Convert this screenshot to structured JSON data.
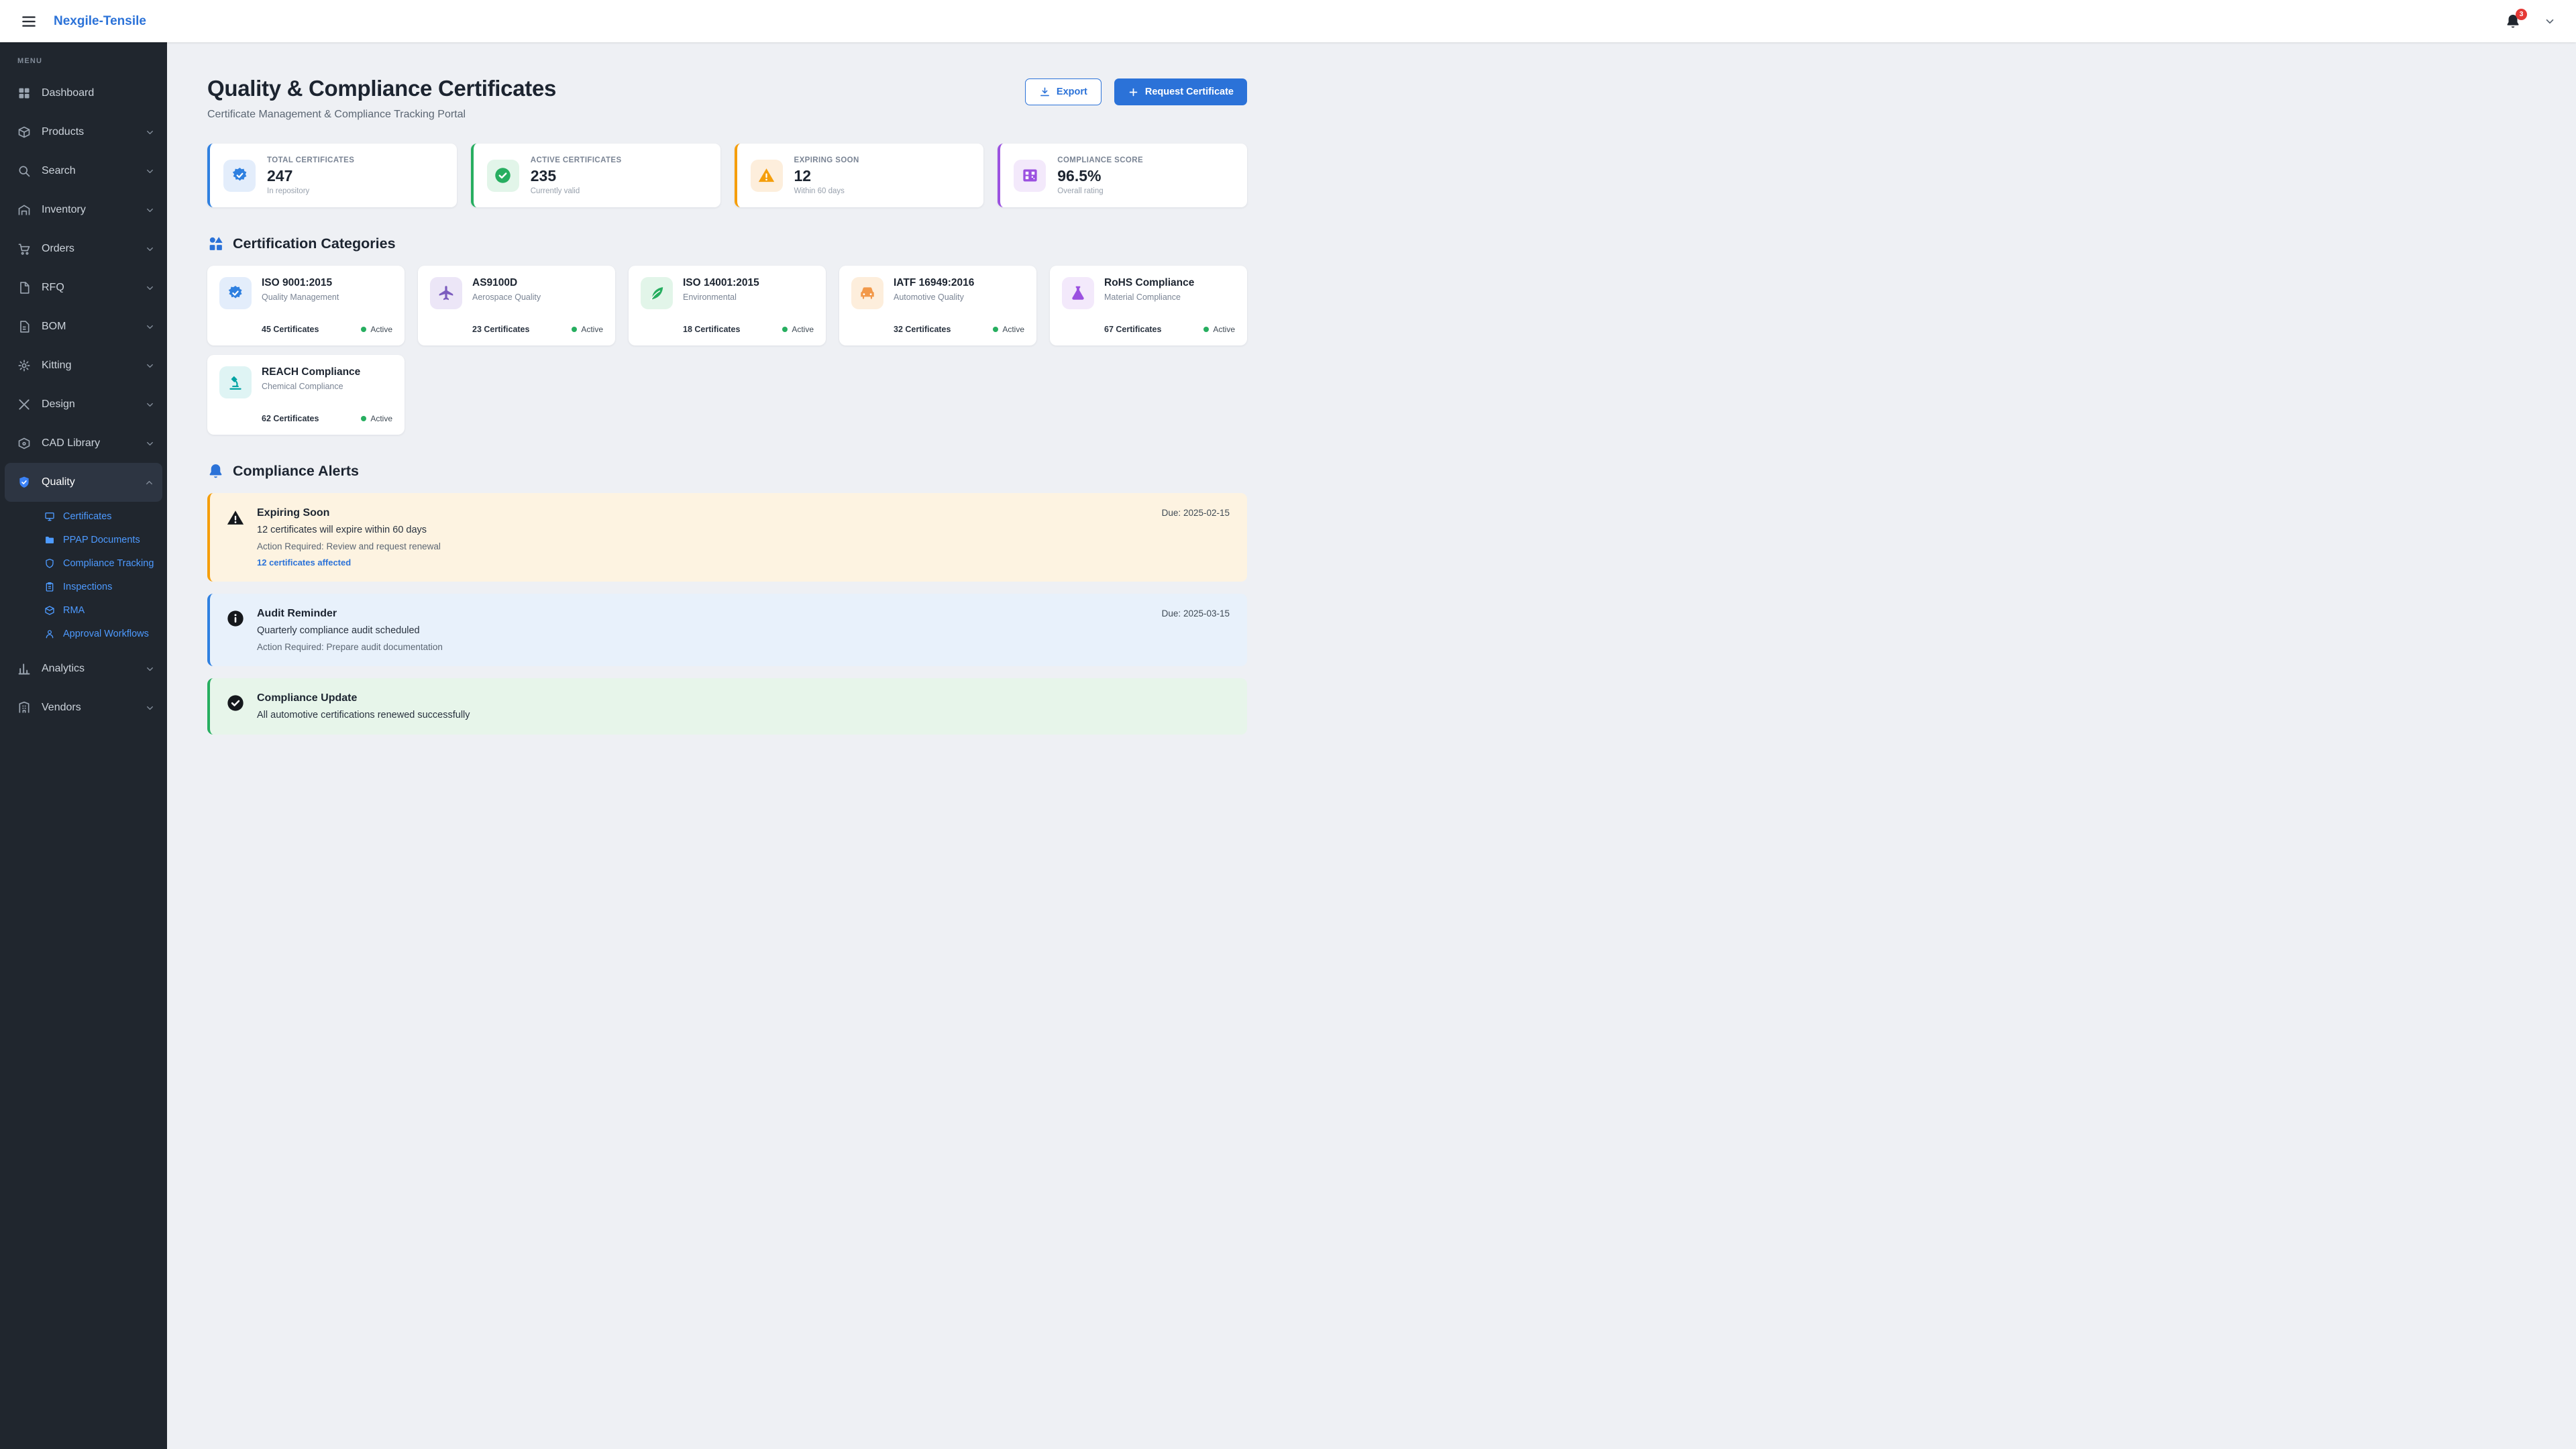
{
  "colors": {
    "primary": "#2b72d8",
    "sidebar_bg": "#20262e",
    "link_blue": "#4d9aff",
    "success": "#27ae60",
    "warning": "#f59e0b",
    "badge_red": "#e53935"
  },
  "topbar": {
    "brand": "Nexgile-Tensile",
    "notification_count": "3"
  },
  "sidebar": {
    "menu_label": "MENU",
    "items": [
      {
        "label": "Dashboard"
      },
      {
        "label": "Products"
      },
      {
        "label": "Search"
      },
      {
        "label": "Inventory"
      },
      {
        "label": "Orders"
      },
      {
        "label": "RFQ"
      },
      {
        "label": "BOM"
      },
      {
        "label": "Kitting"
      },
      {
        "label": "Design"
      },
      {
        "label": "CAD Library"
      },
      {
        "label": "Quality"
      },
      {
        "label": "Analytics"
      },
      {
        "label": "Vendors"
      }
    ],
    "quality_subitems": [
      {
        "label": "Certificates"
      },
      {
        "label": "PPAP Documents"
      },
      {
        "label": "Compliance Tracking"
      },
      {
        "label": "Inspections"
      },
      {
        "label": "RMA"
      },
      {
        "label": "Approval Workflows"
      }
    ]
  },
  "header": {
    "title": "Quality & Compliance Certificates",
    "subtitle": "Certificate Management & Compliance Tracking Portal",
    "export_label": "Export",
    "request_label": "Request Certificate"
  },
  "stats": [
    {
      "label": "TOTAL CERTIFICATES",
      "value": "247",
      "sub": "In repository",
      "color": "#2f80e0",
      "tint": "#e3edfb"
    },
    {
      "label": "ACTIVE CERTIFICATES",
      "value": "235",
      "sub": "Currently valid",
      "color": "#27ae60",
      "tint": "#e2f5e9"
    },
    {
      "label": "EXPIRING SOON",
      "value": "12",
      "sub": "Within 60 days",
      "color": "#f59e0b",
      "tint": "#fdeedc"
    },
    {
      "label": "COMPLIANCE SCORE",
      "value": "96.5%",
      "sub": "Overall rating",
      "color": "#9b51e0",
      "tint": "#f3e9fb"
    }
  ],
  "categories": {
    "heading": "Certification Categories",
    "status_label": "Active",
    "cards": [
      {
        "name": "ISO 9001:2015",
        "desc": "Quality Management",
        "count": "45 Certificates",
        "color": "#2f80e0",
        "tint": "#e3edfb"
      },
      {
        "name": "AS9100D",
        "desc": "Aerospace Quality",
        "count": "23 Certificates",
        "color": "#7c5cbf",
        "tint": "#ece6f7"
      },
      {
        "name": "ISO 14001:2015",
        "desc": "Environmental",
        "count": "18 Certificates",
        "color": "#27ae60",
        "tint": "#e2f5e9"
      },
      {
        "name": "IATF 16949:2016",
        "desc": "Automotive Quality",
        "count": "32 Certificates",
        "color": "#f2994a",
        "tint": "#fdeedc"
      },
      {
        "name": "RoHS Compliance",
        "desc": "Material Compliance",
        "count": "67 Certificates",
        "color": "#9b51e0",
        "tint": "#f3e9fb"
      },
      {
        "name": "REACH Compliance",
        "desc": "Chemical Compliance",
        "count": "62 Certificates",
        "color": "#00a3a3",
        "tint": "#dff4f4"
      }
    ]
  },
  "alerts": {
    "heading": "Compliance Alerts",
    "items": [
      {
        "title": "Expiring Soon",
        "message": "12 certificates will expire within 60 days",
        "action": "Action Required: Review and request renewal",
        "link": "12 certificates affected",
        "due": "Due: 2025-02-15",
        "bg": "#fdf3e1",
        "border": "#f59e0b"
      },
      {
        "title": "Audit Reminder",
        "message": "Quarterly compliance audit scheduled",
        "action": "Action Required: Prepare audit documentation",
        "due": "Due: 2025-03-15",
        "bg": "#e8f1fb",
        "border": "#2f80e0"
      },
      {
        "title": "Compliance Update",
        "message": "All automotive certifications renewed successfully",
        "bg": "#e7f5ea",
        "border": "#27ae60"
      }
    ]
  }
}
